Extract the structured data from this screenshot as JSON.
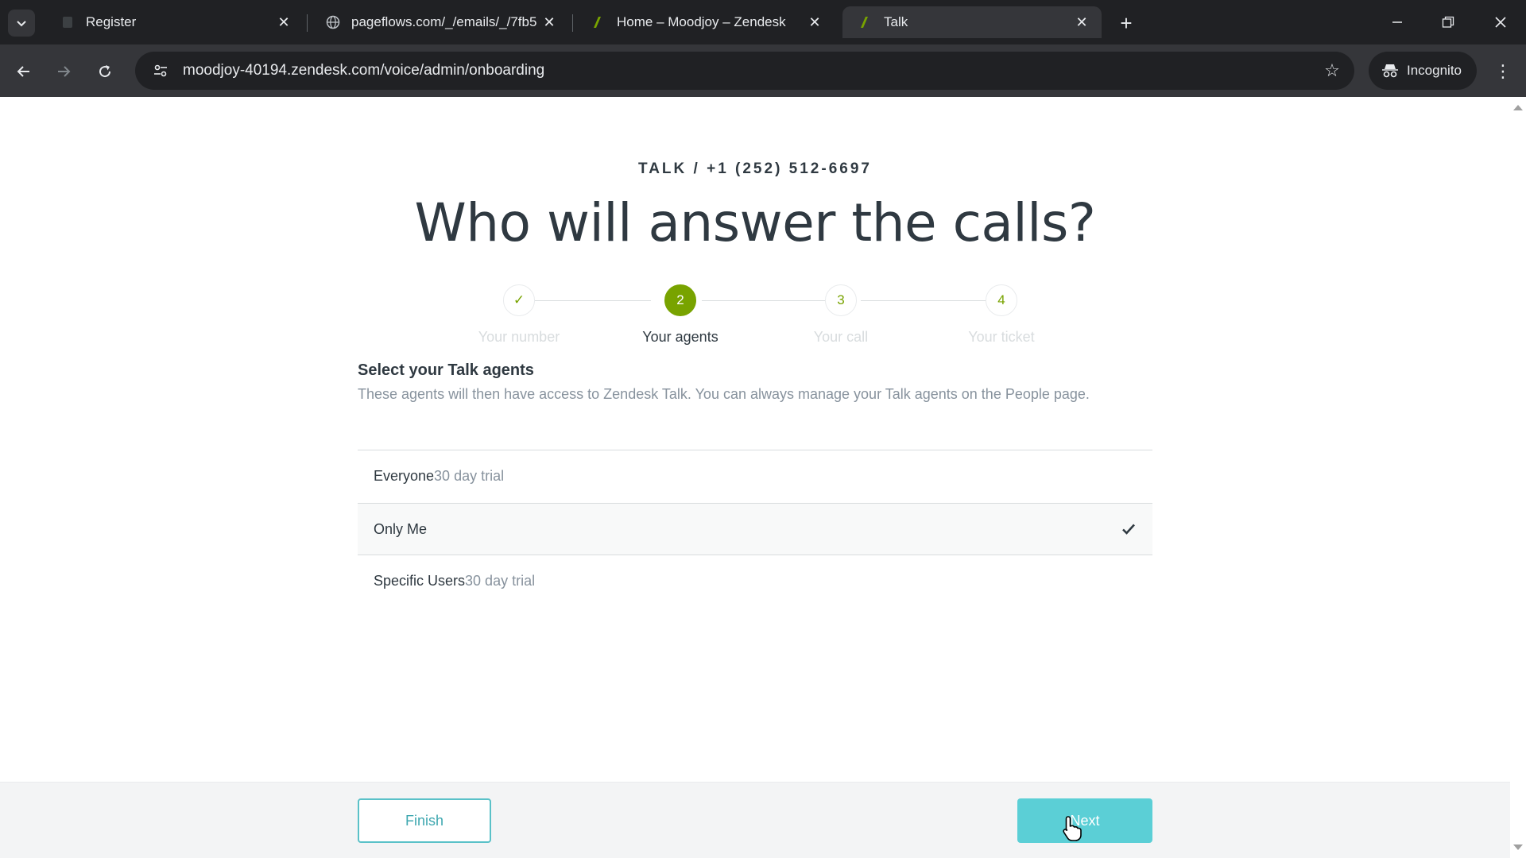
{
  "browser": {
    "tabs": [
      {
        "title": "Register",
        "active": false,
        "favicon": "page-icon"
      },
      {
        "title": "pageflows.com/_/emails/_/7fb5",
        "active": false,
        "favicon": "globe-icon"
      },
      {
        "title": "Home – Moodjoy – Zendesk",
        "active": false,
        "favicon": "zendesk-icon"
      },
      {
        "title": "Talk",
        "active": true,
        "favicon": "zendesk-icon"
      }
    ],
    "url": "moodjoy-40194.zendesk.com/voice/admin/onboarding",
    "incognito_label": "Incognito"
  },
  "page": {
    "breadcrumb": "TALK / +1 (252) 512-6697",
    "headline": "Who will answer the calls?",
    "steps": [
      {
        "label": "Your number",
        "marker": "✓",
        "state": "done"
      },
      {
        "label": "Your agents",
        "marker": "2",
        "state": "current"
      },
      {
        "label": "Your call",
        "marker": "3",
        "state": "upcoming"
      },
      {
        "label": "Your ticket",
        "marker": "4",
        "state": "upcoming"
      }
    ],
    "section_title": "Select your Talk agents",
    "section_desc": "These agents will then have access to Zendesk Talk. You can always manage your Talk agents on the People page.",
    "options": [
      {
        "label": "Everyone",
        "trial": "30 day trial",
        "selected": false
      },
      {
        "label": "Only Me",
        "trial": "",
        "selected": true
      },
      {
        "label": "Specific Users",
        "trial": "30 day trial",
        "selected": false
      }
    ],
    "footer": {
      "finish_label": "Finish",
      "next_label": "Next"
    }
  },
  "colors": {
    "accent_green": "#78a300",
    "next_button": "#5bcfd6",
    "finish_border": "#5ac1c8"
  }
}
